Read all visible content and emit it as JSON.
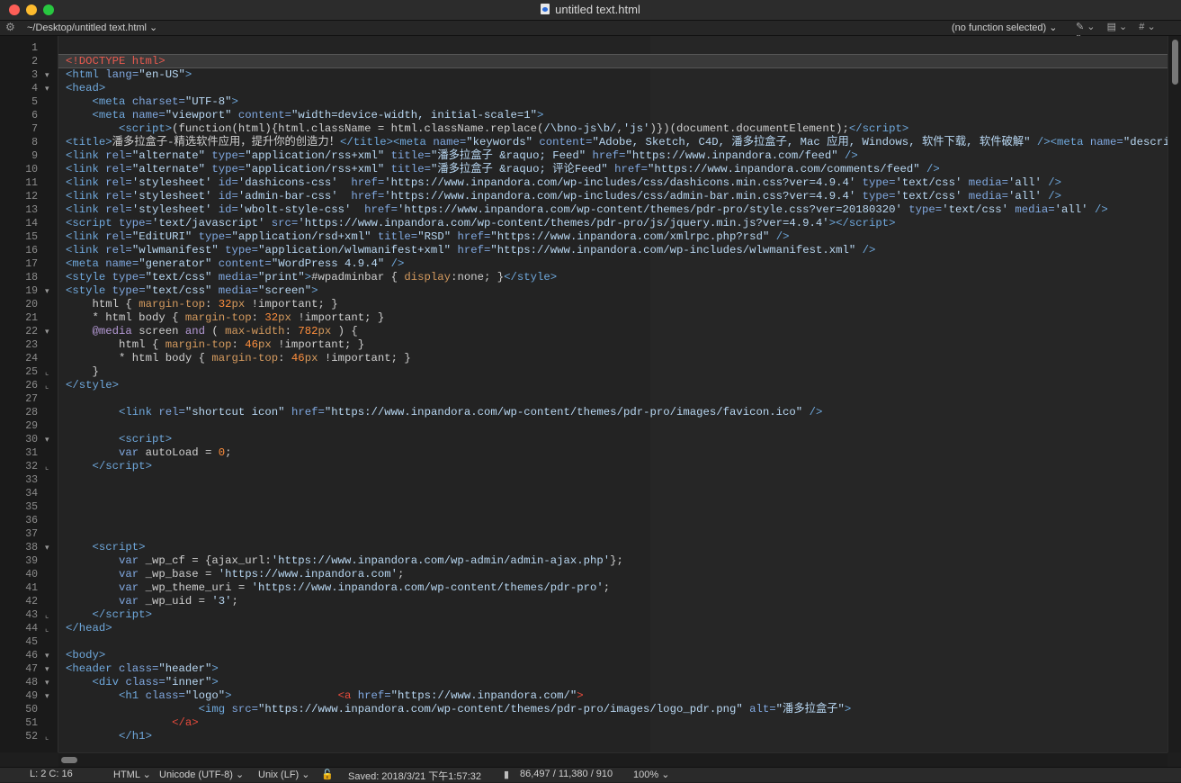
{
  "window": {
    "title": "untitled text.html"
  },
  "navbar": {
    "path": "~/Desktop/untitled text.html ⌄",
    "function": "(no function selected) ⌄",
    "tools": [
      "✎ ⌄",
      "▤ ⌄",
      "# ⌄",
      "▯"
    ]
  },
  "editor": {
    "lines": [
      {
        "n": "1",
        "f": "",
        "h": ""
      },
      {
        "n": "2",
        "f": "",
        "h": "<span class=\"doctype\">&lt;!DOCTYPE html&gt;</span>"
      },
      {
        "n": "3",
        "f": "▾",
        "h": "<span class=\"tag\">&lt;html</span> <span class=\"attr\">lang=</span><span class=\"str\">\"en-US\"</span><span class=\"tag\">&gt;</span>"
      },
      {
        "n": "4",
        "f": "▾",
        "h": "<span class=\"tag\">&lt;head&gt;</span>"
      },
      {
        "n": "5",
        "f": "",
        "h": "    <span class=\"tag\">&lt;meta</span> <span class=\"attr\">charset=</span><span class=\"str\">\"UTF-8\"</span><span class=\"tag\">&gt;</span>"
      },
      {
        "n": "6",
        "f": "",
        "h": "    <span class=\"tag\">&lt;meta</span> <span class=\"attr\">name=</span><span class=\"str\">\"viewport\"</span> <span class=\"attr\">content=</span><span class=\"str\">\"width=device-width, initial-scale=1\"</span><span class=\"tag\">&gt;</span>"
      },
      {
        "n": "7",
        "f": "",
        "h": "        <span class=\"tag\">&lt;script&gt;</span><span class=\"plain\">(function(html){html.className = html.className.replace(</span><span class=\"str\">/\\bno-js\\b/</span><span class=\"plain\">,</span><span class=\"str\">'js'</span><span class=\"plain\">)})(document.documentElement);</span><span class=\"tag\">&lt;/script&gt;</span>"
      },
      {
        "n": "8",
        "f": "",
        "h": "<span class=\"tag\">&lt;title&gt;</span><span class=\"plain\">潘多拉盒子-精选软件应用，提升你的创造力！</span><span class=\"tag\">&lt;/title&gt;&lt;meta</span> <span class=\"attr\">name=</span><span class=\"str\">\"keywords\"</span> <span class=\"attr\">content=</span><span class=\"str\">\"Adobe, Sketch, C4D, 潘多拉盒子, Mac 应用, Windows, 软件下载, 软件破解\"</span> <span class=\"tag\">/&gt;&lt;meta</span> <span class=\"attr\">name=</span><span class=\"str\">\"descriptio</span>"
      },
      {
        "n": "9",
        "f": "",
        "h": "<span class=\"tag\">&lt;link</span> <span class=\"attr\">rel=</span><span class=\"str\">\"alternate\"</span> <span class=\"attr\">type=</span><span class=\"str\">\"application/rss+xml\"</span> <span class=\"attr\">title=</span><span class=\"str\">\"潘多拉盒子 &amp;raquo; Feed\"</span> <span class=\"attr\">href=</span><span class=\"str\">\"https://www.inpandora.com/feed\"</span> <span class=\"tag\">/&gt;</span>"
      },
      {
        "n": "10",
        "f": "",
        "h": "<span class=\"tag\">&lt;link</span> <span class=\"attr\">rel=</span><span class=\"str\">\"alternate\"</span> <span class=\"attr\">type=</span><span class=\"str\">\"application/rss+xml\"</span> <span class=\"attr\">title=</span><span class=\"str\">\"潘多拉盒子 &amp;raquo; 评论Feed\"</span> <span class=\"attr\">href=</span><span class=\"str\">\"https://www.inpandora.com/comments/feed\"</span> <span class=\"tag\">/&gt;</span>"
      },
      {
        "n": "11",
        "f": "",
        "h": "<span class=\"tag\">&lt;link</span> <span class=\"attr\">rel=</span><span class=\"str\">'stylesheet'</span> <span class=\"attr\">id=</span><span class=\"str\">'dashicons-css'</span>  <span class=\"attr\">href=</span><span class=\"str\">'https://www.inpandora.com/wp-includes/css/dashicons.min.css?ver=4.9.4'</span> <span class=\"attr\">type=</span><span class=\"str\">'text/css'</span> <span class=\"attr\">media=</span><span class=\"str\">'all'</span> <span class=\"tag\">/&gt;</span>"
      },
      {
        "n": "12",
        "f": "",
        "h": "<span class=\"tag\">&lt;link</span> <span class=\"attr\">rel=</span><span class=\"str\">'stylesheet'</span> <span class=\"attr\">id=</span><span class=\"str\">'admin-bar-css'</span>  <span class=\"attr\">href=</span><span class=\"str\">'https://www.inpandora.com/wp-includes/css/admin-bar.min.css?ver=4.9.4'</span> <span class=\"attr\">type=</span><span class=\"str\">'text/css'</span> <span class=\"attr\">media=</span><span class=\"str\">'all'</span> <span class=\"tag\">/&gt;</span>"
      },
      {
        "n": "13",
        "f": "",
        "h": "<span class=\"tag\">&lt;link</span> <span class=\"attr\">rel=</span><span class=\"str\">'stylesheet'</span> <span class=\"attr\">id=</span><span class=\"str\">'wbolt-style-css'</span>  <span class=\"attr\">href=</span><span class=\"str\">'https://www.inpandora.com/wp-content/themes/pdr-pro/style.css?ver=20180320'</span> <span class=\"attr\">type=</span><span class=\"str\">'text/css'</span> <span class=\"attr\">media=</span><span class=\"str\">'all'</span> <span class=\"tag\">/&gt;</span>"
      },
      {
        "n": "14",
        "f": "",
        "h": "<span class=\"tag\">&lt;script</span> <span class=\"attr\">type=</span><span class=\"str\">'text/javascript'</span> <span class=\"attr\">src=</span><span class=\"str\">'https://www.inpandora.com/wp-content/themes/pdr-pro/js/jquery.min.js?ver=4.9.4'</span><span class=\"tag\">&gt;&lt;/script&gt;</span>"
      },
      {
        "n": "15",
        "f": "",
        "h": "<span class=\"tag\">&lt;link</span> <span class=\"attr\">rel=</span><span class=\"str\">\"EditURI\"</span> <span class=\"attr\">type=</span><span class=\"str\">\"application/rsd+xml\"</span> <span class=\"attr\">title=</span><span class=\"str\">\"RSD\"</span> <span class=\"attr\">href=</span><span class=\"str\">\"https://www.inpandora.com/xmlrpc.php?rsd\"</span> <span class=\"tag\">/&gt;</span>"
      },
      {
        "n": "16",
        "f": "",
        "h": "<span class=\"tag\">&lt;link</span> <span class=\"attr\">rel=</span><span class=\"str\">\"wlwmanifest\"</span> <span class=\"attr\">type=</span><span class=\"str\">\"application/wlwmanifest+xml\"</span> <span class=\"attr\">href=</span><span class=\"str\">\"https://www.inpandora.com/wp-includes/wlwmanifest.xml\"</span> <span class=\"tag\">/&gt;</span>"
      },
      {
        "n": "17",
        "f": "",
        "h": "<span class=\"tag\">&lt;meta</span> <span class=\"attr\">name=</span><span class=\"str\">\"generator\"</span> <span class=\"attr\">content=</span><span class=\"str\">\"WordPress 4.9.4\"</span> <span class=\"tag\">/&gt;</span>"
      },
      {
        "n": "18",
        "f": "",
        "h": "<span class=\"tag\">&lt;style</span> <span class=\"attr\">type=</span><span class=\"str\">\"text/css\"</span> <span class=\"attr\">media=</span><span class=\"str\">\"print\"</span><span class=\"tag\">&gt;</span><span class=\"plain\">#wpadminbar { </span><span class=\"prop\">display</span><span class=\"plain\">:none; }</span><span class=\"tag\">&lt;/style&gt;</span>"
      },
      {
        "n": "19",
        "f": "▾",
        "h": "<span class=\"tag\">&lt;style</span> <span class=\"attr\">type=</span><span class=\"str\">\"text/css\"</span> <span class=\"attr\">media=</span><span class=\"str\">\"screen\"</span><span class=\"tag\">&gt;</span>"
      },
      {
        "n": "20",
        "f": "",
        "h": "    <span class=\"plain\">html { </span><span class=\"prop\">margin-top</span><span class=\"plain\">: </span><span class=\"val\">32</span><span class=\"prop\">px</span><span class=\"plain\"> !important; }</span>"
      },
      {
        "n": "21",
        "f": "",
        "h": "    <span class=\"plain\">* html body { </span><span class=\"prop\">margin-top</span><span class=\"plain\">: </span><span class=\"val\">32</span><span class=\"prop\">px</span><span class=\"plain\"> !important; }</span>"
      },
      {
        "n": "22",
        "f": "▾",
        "h": "    <span class=\"cssk\">@media</span><span class=\"plain\"> screen </span><span class=\"cssk\">and</span><span class=\"plain\"> ( </span><span class=\"prop\">max-width</span><span class=\"plain\">: </span><span class=\"val\">782</span><span class=\"prop\">px</span><span class=\"plain\"> ) {</span>"
      },
      {
        "n": "23",
        "f": "",
        "h": "        <span class=\"plain\">html { </span><span class=\"prop\">margin-top</span><span class=\"plain\">: </span><span class=\"val\">46</span><span class=\"prop\">px</span><span class=\"plain\"> !important; }</span>"
      },
      {
        "n": "24",
        "f": "",
        "h": "        <span class=\"plain\">* html body { </span><span class=\"prop\">margin-top</span><span class=\"plain\">: </span><span class=\"val\">46</span><span class=\"prop\">px</span><span class=\"plain\"> !important; }</span>"
      },
      {
        "n": "25",
        "f": "⌞",
        "h": "    <span class=\"plain\">}</span>"
      },
      {
        "n": "26",
        "f": "⌞",
        "h": "<span class=\"tag\">&lt;/style&gt;</span>"
      },
      {
        "n": "27",
        "f": "",
        "h": ""
      },
      {
        "n": "28",
        "f": "",
        "h": "        <span class=\"tag\">&lt;link</span> <span class=\"attr\">rel=</span><span class=\"str\">\"shortcut icon\"</span> <span class=\"attr\">href=</span><span class=\"str\">\"https://www.inpandora.com/wp-content/themes/pdr-pro/images/favicon.ico\"</span> <span class=\"tag\">/&gt;</span>"
      },
      {
        "n": "29",
        "f": "",
        "h": ""
      },
      {
        "n": "30",
        "f": "▾",
        "h": "        <span class=\"tag\">&lt;script&gt;</span>"
      },
      {
        "n": "31",
        "f": "",
        "h": "        <span class=\"attr\">var</span><span class=\"plain\"> autoLoad = </span><span class=\"val\">0</span><span class=\"plain\">;</span>"
      },
      {
        "n": "32",
        "f": "⌞",
        "h": "    <span class=\"tag\">&lt;/script&gt;</span>"
      },
      {
        "n": "33",
        "f": "",
        "h": ""
      },
      {
        "n": "34",
        "f": "",
        "h": ""
      },
      {
        "n": "35",
        "f": "",
        "h": ""
      },
      {
        "n": "36",
        "f": "",
        "h": ""
      },
      {
        "n": "37",
        "f": "",
        "h": ""
      },
      {
        "n": "38",
        "f": "▾",
        "h": "    <span class=\"tag\">&lt;script&gt;</span>"
      },
      {
        "n": "39",
        "f": "",
        "h": "        <span class=\"attr\">var</span><span class=\"plain\"> _wp_cf = {ajax_url:</span><span class=\"str\">'https://www.inpandora.com/wp-admin/admin-ajax.php'</span><span class=\"plain\">};</span>"
      },
      {
        "n": "40",
        "f": "",
        "h": "        <span class=\"attr\">var</span><span class=\"plain\"> _wp_base = </span><span class=\"str\">'https://www.inpandora.com'</span><span class=\"plain\">;</span>"
      },
      {
        "n": "41",
        "f": "",
        "h": "        <span class=\"attr\">var</span><span class=\"plain\"> _wp_theme_uri = </span><span class=\"str\">'https://www.inpandora.com/wp-content/themes/pdr-pro'</span><span class=\"plain\">;</span>"
      },
      {
        "n": "42",
        "f": "",
        "h": "        <span class=\"attr\">var</span><span class=\"plain\"> _wp_uid = </span><span class=\"str\">'3'</span><span class=\"plain\">;</span>"
      },
      {
        "n": "43",
        "f": "⌞",
        "h": "    <span class=\"tag\">&lt;/script&gt;</span>"
      },
      {
        "n": "44",
        "f": "⌞",
        "h": "<span class=\"tag\">&lt;/head&gt;</span>"
      },
      {
        "n": "45",
        "f": "",
        "h": ""
      },
      {
        "n": "46",
        "f": "▾",
        "h": "<span class=\"tag\">&lt;body&gt;</span>"
      },
      {
        "n": "47",
        "f": "▾",
        "h": "<span class=\"tag\">&lt;header</span> <span class=\"attr\">class=</span><span class=\"str\">\"header\"</span><span class=\"tag\">&gt;</span>"
      },
      {
        "n": "48",
        "f": "▾",
        "h": "    <span class=\"tag\">&lt;div</span> <span class=\"attr\">class=</span><span class=\"str\">\"inner\"</span><span class=\"tag\">&gt;</span>"
      },
      {
        "n": "49",
        "f": "▾",
        "h": "        <span class=\"tag\">&lt;h1</span> <span class=\"attr\">class=</span><span class=\"str\">\"logo\"</span><span class=\"tag\">&gt;</span>                <span class=\"redtag\">&lt;a</span> <span class=\"attr\">href=</span><span class=\"str\">\"https://www.inpandora.com/\"</span><span class=\"redtag\">&gt;</span>"
      },
      {
        "n": "50",
        "f": "",
        "h": "                    <span class=\"tag\">&lt;img</span> <span class=\"attr\">src=</span><span class=\"str\">\"https://www.inpandora.com/wp-content/themes/pdr-pro/images/logo_pdr.png\"</span> <span class=\"attr\">alt=</span><span class=\"str\">\"潘多拉盒子\"</span><span class=\"tag\">&gt;</span>"
      },
      {
        "n": "51",
        "f": "",
        "h": "                <span class=\"redtag\">&lt;/a&gt;</span>"
      },
      {
        "n": "52",
        "f": "⌞",
        "h": "        <span class=\"tag\">&lt;/h1&gt;</span>"
      }
    ]
  },
  "status": {
    "position": "L: 2 C: 16",
    "language": "HTML ⌄",
    "encoding": "Unicode (UTF-8) ⌄",
    "line_endings": "Unix (LF) ⌄",
    "saved": "Saved: 2018/3/21 下午1:57:32",
    "counts": "86,497 / 11,380 / 910",
    "zoom": "100% ⌄"
  }
}
